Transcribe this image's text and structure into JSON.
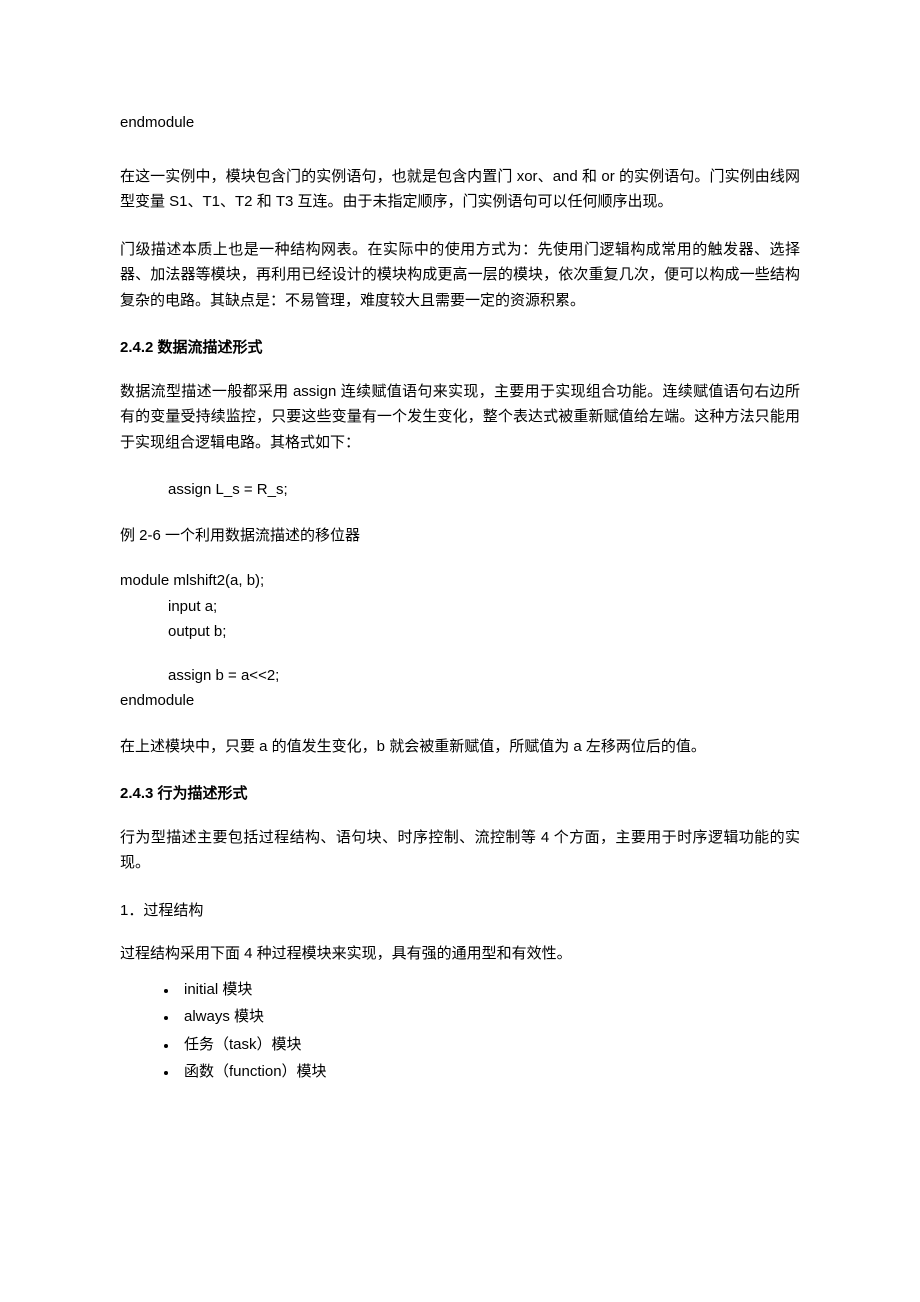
{
  "top_code": "endmodule",
  "para1": "在这一实例中，模块包含门的实例语句，也就是包含内置门 xor、and 和 or 的实例语句。门实例由线网型变量 S1、T1、T2 和 T3 互连。由于未指定顺序，门实例语句可以任何顺序出现。",
  "para2": "门级描述本质上也是一种结构网表。在实际中的使用方式为：先使用门逻辑构成常用的触发器、选择器、加法器等模块，再利用已经设计的模块构成更高一层的模块，依次重复几次，便可以构成一些结构复杂的电路。其缺点是：不易管理，难度较大且需要一定的资源积累。",
  "heading242": "2.4.2 数据流描述形式",
  "para3": "数据流型描述一般都采用 assign 连续赋值语句来实现，主要用于实现组合功能。连续赋值语句右边所有的变量受持续监控，只要这些变量有一个发生变化，整个表达式被重新赋值给左端。这种方法只能用于实现组合逻辑电路。其格式如下：",
  "assign_syntax": "assign L_s = R_s;",
  "example_label": "例 2-6  一个利用数据流描述的移位器",
  "code2": {
    "l1": "module mlshift2(a, b);",
    "l2": "input a;",
    "l3": "output b;",
    "l4": "assign b = a<<2;",
    "l5": "endmodule"
  },
  "para4": "在上述模块中，只要 a 的值发生变化，b 就会被重新赋值，所赋值为 a 左移两位后的值。",
  "heading243": "2.4.3 行为描述形式",
  "para5": "行为型描述主要包括过程结构、语句块、时序控制、流控制等 4 个方面，主要用于时序逻辑功能的实现。",
  "subhead1": "1．过程结构",
  "para6": "过程结构采用下面 4 种过程模块来实现，具有强的通用型和有效性。",
  "bullets": {
    "b1": "initial 模块",
    "b2": "always 模块",
    "b3": "任务（task）模块",
    "b4": " 函数（function）模块"
  }
}
